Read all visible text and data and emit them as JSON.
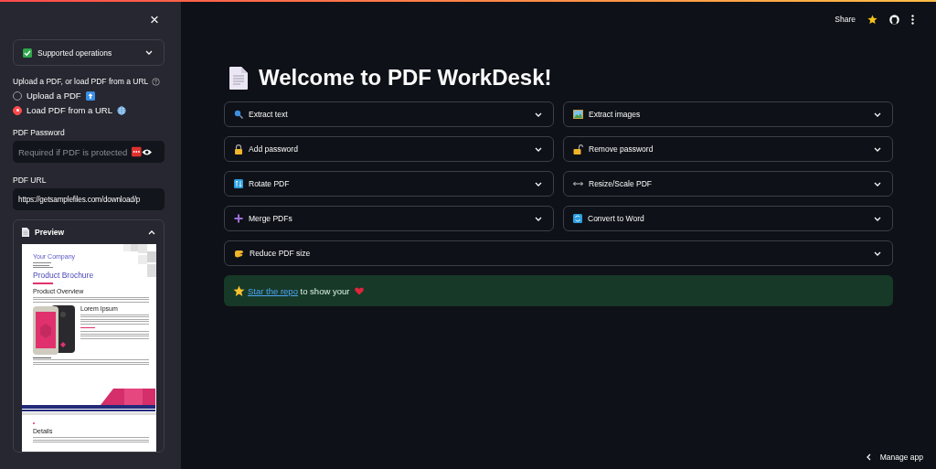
{
  "sidebar": {
    "close": "×",
    "supported_operations": {
      "label": "Supported operations",
      "expanded": false
    },
    "source": {
      "label": "Upload a PDF, or load PDF from a URL",
      "options": [
        {
          "label": "Upload a PDF",
          "selected": false
        },
        {
          "label": "Load PDF from a URL",
          "selected": true
        }
      ]
    },
    "password": {
      "label": "PDF Password",
      "placeholder": "Required if PDF is protected"
    },
    "url": {
      "label": "PDF URL",
      "value": "https://getsamplefiles.com/download/p"
    },
    "preview": {
      "label": "Preview",
      "expanded": true,
      "document": {
        "company": "Your Company",
        "title": "Product Brochure",
        "section": "Product Overview",
        "subheading": "Lorem Ipsum",
        "page2_heading": "Details"
      }
    }
  },
  "header": {
    "share": "Share"
  },
  "main": {
    "title": "Welcome to PDF WorkDesk!",
    "operations": [
      {
        "label": "Extract text",
        "expanded": false
      },
      {
        "label": "Extract images",
        "expanded": false
      },
      {
        "label": "Add password",
        "expanded": false
      },
      {
        "label": "Remove password",
        "expanded": false
      },
      {
        "label": "Rotate PDF",
        "expanded": false
      },
      {
        "label": "Resize/Scale PDF",
        "expanded": false
      },
      {
        "label": "Merge PDFs",
        "expanded": false
      },
      {
        "label": "Convert to Word",
        "expanded": false
      },
      {
        "label": "Reduce PDF size",
        "expanded": false
      }
    ],
    "banner": {
      "link": "Star the repo",
      "text": "to show your"
    }
  },
  "footer": {
    "manage": "Manage app"
  }
}
